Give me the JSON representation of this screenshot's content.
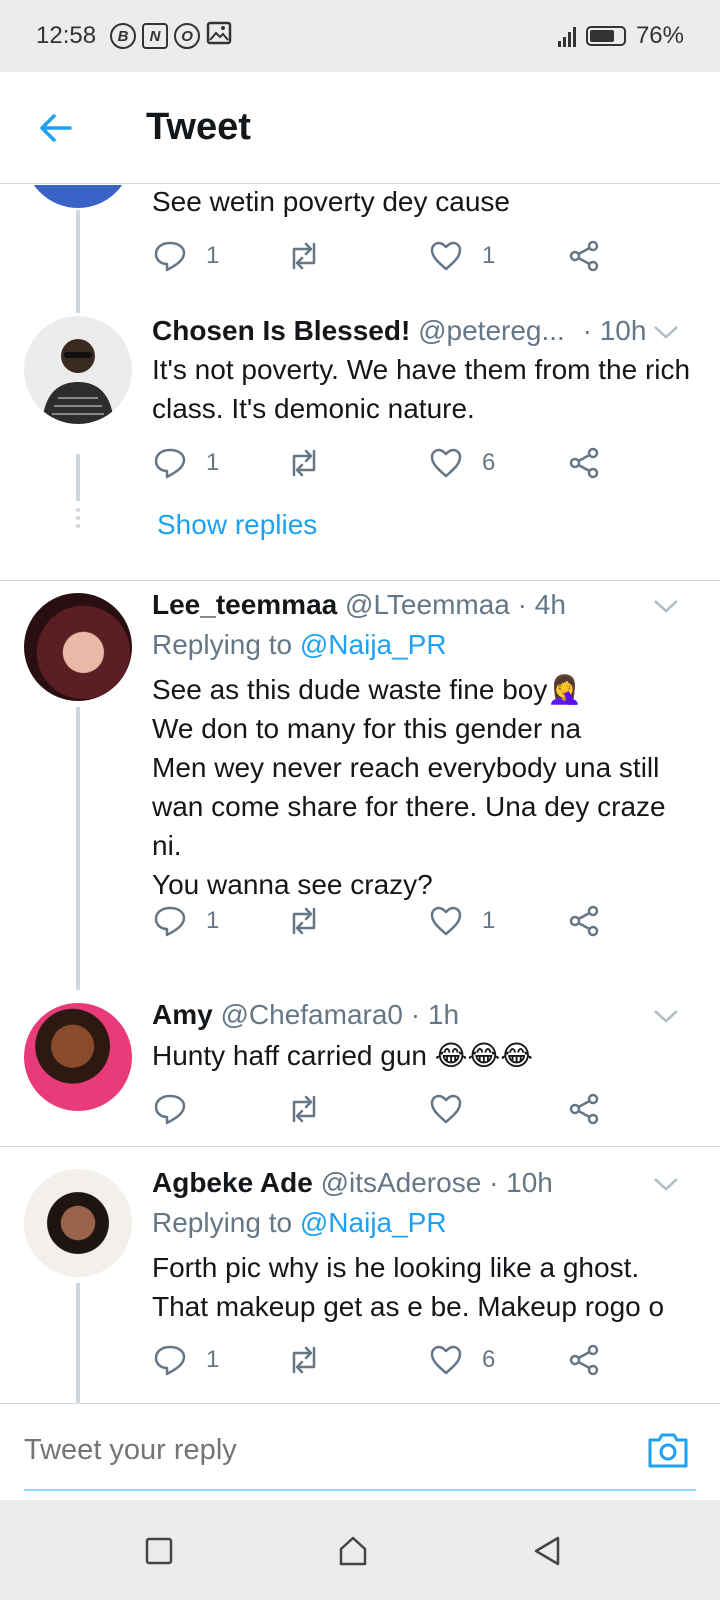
{
  "status_bar": {
    "time": "12:58",
    "notification_icons": [
      "B",
      "N",
      "O"
    ],
    "battery": "76%",
    "battery_level": 0.76
  },
  "header": {
    "title": "Tweet"
  },
  "tweets": [
    {
      "text": "See wetin poverty dey cause",
      "replies": "1",
      "retweets": "",
      "likes": "1"
    },
    {
      "name": "Chosen Is Blessed!",
      "handle": "@petereg...",
      "time": "· 10h",
      "text": "It's not poverty. We have them from the rich class. It's demonic nature.",
      "replies": "1",
      "retweets": "",
      "likes": "6",
      "show_replies": "Show replies"
    },
    {
      "name": "Lee_teemmaa",
      "handle": "@LTeemmaa",
      "time": "· 4h",
      "replying_label": "Replying to",
      "replying_to": "@Naija_PR",
      "text_lines": [
        "See as this dude waste fine boy🤦‍♀️",
        "We don to many for this gender na",
        "Men wey never reach everybody una still wan come share for there. Una dey craze ni.",
        "You wanna see crazy?"
      ],
      "replies": "1",
      "retweets": "",
      "likes": "1"
    },
    {
      "name": "Amy",
      "handle": "@Chefamara0",
      "time": "· 1h",
      "text": "Hunty haff carried gun 😂😂😂",
      "replies": "",
      "retweets": "",
      "likes": ""
    },
    {
      "name": "Agbeke Ade",
      "handle": "@itsAderose",
      "time": "· 10h",
      "replying_label": "Replying to",
      "replying_to": "@Naija_PR",
      "text": "Forth pic why is he looking like a ghost. That makeup get as e be. Makeup rogo o",
      "replies": "1",
      "retweets": "",
      "likes": "6"
    }
  ],
  "reply_bar": {
    "placeholder": "Tweet your reply"
  },
  "colors": {
    "accent": "#1da1f2",
    "text": "#14171a",
    "secondary": "#657786",
    "divider": "#d8d8d8"
  }
}
